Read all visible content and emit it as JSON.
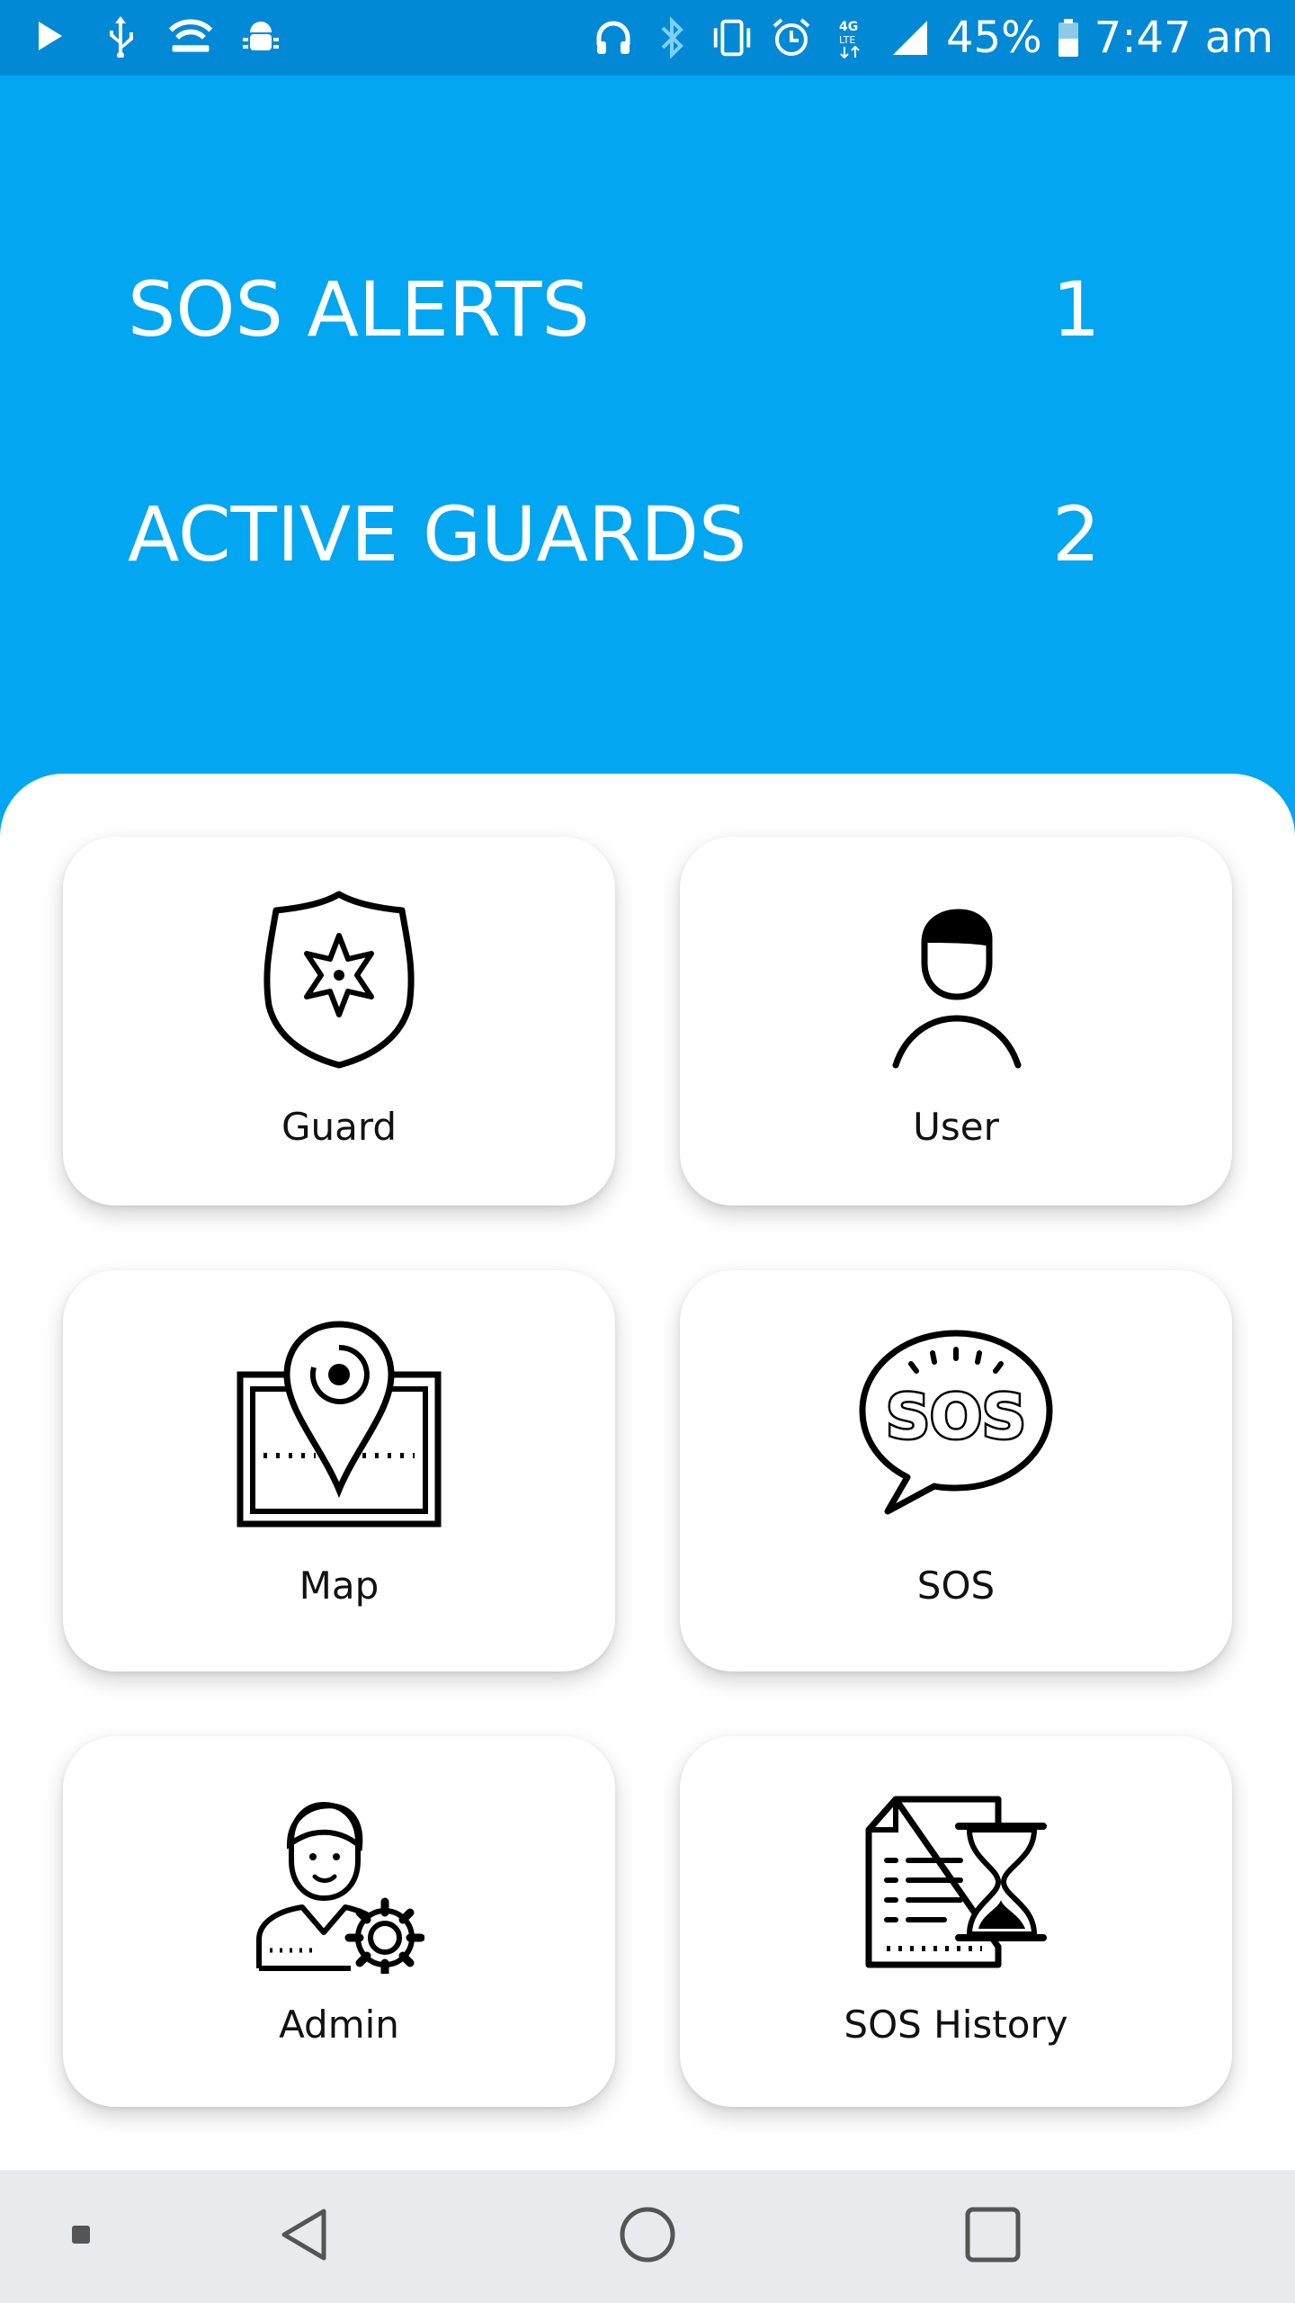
{
  "status_bar": {
    "left_icons": [
      "play-icon",
      "usb-icon",
      "wifi-hotspot-icon",
      "android-debug-icon"
    ],
    "right_icons": [
      "headphones-icon",
      "bluetooth-icon",
      "vibrate-icon",
      "alarm-icon",
      "4g-lte-icon",
      "signal-icon"
    ],
    "battery_percent": "45%",
    "battery_icon": "battery-charging-icon",
    "time": "7:47 am"
  },
  "stats": [
    {
      "label": "SOS ALERTS",
      "value": "1"
    },
    {
      "label": "ACTIVE GUARDS",
      "value": "2"
    }
  ],
  "menu": [
    {
      "label": "Guard",
      "icon": "guard-badge-icon"
    },
    {
      "label": "User",
      "icon": "user-icon"
    },
    {
      "label": "Map",
      "icon": "map-pin-icon"
    },
    {
      "label": "SOS",
      "icon": "sos-bubble-icon"
    },
    {
      "label": "Admin",
      "icon": "admin-settings-icon"
    },
    {
      "label": "SOS History",
      "icon": "sos-history-icon"
    }
  ],
  "navbar": {
    "icons": [
      "dot-icon",
      "back-icon",
      "home-icon",
      "recents-icon"
    ]
  },
  "colors": {
    "header_blue": "#03a6f0",
    "status_bar_blue": "#0289d6",
    "card_background": "#ffffff",
    "nav_bar_gray": "#e9eaed"
  }
}
